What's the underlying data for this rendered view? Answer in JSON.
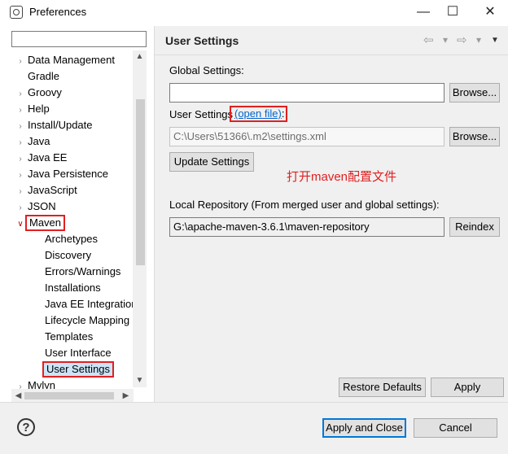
{
  "window": {
    "title": "Preferences",
    "minimize_glyph": "—",
    "maximize_glyph": "☐",
    "close_glyph": "✕"
  },
  "filter": {
    "value": "",
    "placeholder": ""
  },
  "tree": {
    "items": [
      {
        "label": "Data Management",
        "expanded": false
      },
      {
        "label": "Gradle",
        "expanded": null
      },
      {
        "label": "Groovy",
        "expanded": false
      },
      {
        "label": "Help",
        "expanded": false
      },
      {
        "label": "Install/Update",
        "expanded": false
      },
      {
        "label": "Java",
        "expanded": false
      },
      {
        "label": "Java EE",
        "expanded": false
      },
      {
        "label": "Java Persistence",
        "expanded": false
      },
      {
        "label": "JavaScript",
        "expanded": false
      },
      {
        "label": "JSON",
        "expanded": false
      },
      {
        "label": "Maven",
        "expanded": true
      },
      {
        "label": "Archetypes"
      },
      {
        "label": "Discovery"
      },
      {
        "label": "Errors/Warnings"
      },
      {
        "label": "Installations"
      },
      {
        "label": "Java EE Integration"
      },
      {
        "label": "Lifecycle Mapping"
      },
      {
        "label": "Templates"
      },
      {
        "label": "User Interface"
      },
      {
        "label": "User Settings",
        "selected": true
      },
      {
        "label": "Mylyn",
        "expanded": false
      }
    ]
  },
  "page": {
    "title": "User Settings",
    "global_settings": {
      "label": "Global Settings:",
      "value": "",
      "browse_label": "Browse..."
    },
    "user_settings": {
      "label_prefix": "User Settings ",
      "link_text": "(open file)",
      "label_suffix": ":",
      "value": "C:\\Users\\51366\\.m2\\settings.xml",
      "browse_label": "Browse..."
    },
    "update_button": "Update Settings",
    "annotation": "打开maven配置文件",
    "local_repo": {
      "label": "Local Repository (From merged user and global settings):",
      "value": "G:\\apache-maven-3.6.1\\maven-repository",
      "reindex_label": "Reindex"
    },
    "restore_defaults": "Restore Defaults",
    "apply": "Apply"
  },
  "nav": {
    "back": "⇦",
    "dropdown1": "▾",
    "forward": "⇨",
    "dropdown2": "▾",
    "menu": "▼"
  },
  "footer": {
    "help_glyph": "?",
    "apply_close": "Apply and Close",
    "cancel": "Cancel"
  },
  "colors": {
    "highlight_red": "#e02020",
    "link_blue": "#0066cc",
    "selection": "#cce4f7"
  }
}
